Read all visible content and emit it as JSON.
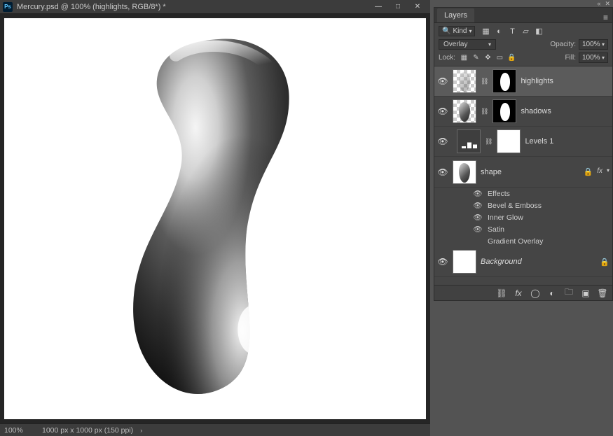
{
  "document": {
    "icon_text": "Ps",
    "title": "Mercury.psd @ 100% (highlights, RGB/8*) *",
    "win_min": "—",
    "win_max": "□",
    "win_close": "✕",
    "zoom": "100%",
    "doc_info": "1000 px x 1000 px (150 ppi)",
    "chev": "›"
  },
  "right_top": {
    "collapse": "«",
    "close": "✕"
  },
  "layers_panel": {
    "tab": "Layers",
    "menu": "≡",
    "filter": {
      "kind_label": "Kind",
      "chev": "▾",
      "icons": {
        "image": "▦",
        "adjust": "◐",
        "type": "T",
        "shape": "▱",
        "smart": "◧"
      }
    },
    "blend": {
      "mode": "Overlay",
      "chev": "▾",
      "opacity_label": "Opacity:",
      "opacity": "100%"
    },
    "lock": {
      "label": "Lock:",
      "icons": {
        "trans": "▦",
        "pixels": "✎",
        "pos": "✥",
        "nest": "▭",
        "all": "🔒"
      },
      "fill_label": "Fill:",
      "fill": "100%"
    },
    "layers": {
      "highlights": {
        "name": "highlights"
      },
      "shadows": {
        "name": "shadows"
      },
      "levels": {
        "name": "Levels 1"
      },
      "shape": {
        "name": "shape",
        "fx": "fx",
        "chev": "▾"
      },
      "effects": {
        "header": "Effects",
        "bevel": "Bevel & Emboss",
        "inner_glow": "Inner Glow",
        "satin": "Satin",
        "gradient": "Gradient Overlay"
      },
      "background": {
        "name": "Background",
        "lock": "🔒"
      }
    },
    "footer": {
      "link": "⛓",
      "fx": "fx",
      "mask": "◯",
      "adjust": "◐",
      "group": "🗀",
      "new": "▣",
      "trash": "🗑"
    }
  },
  "icons": {
    "eye": "👁"
  }
}
